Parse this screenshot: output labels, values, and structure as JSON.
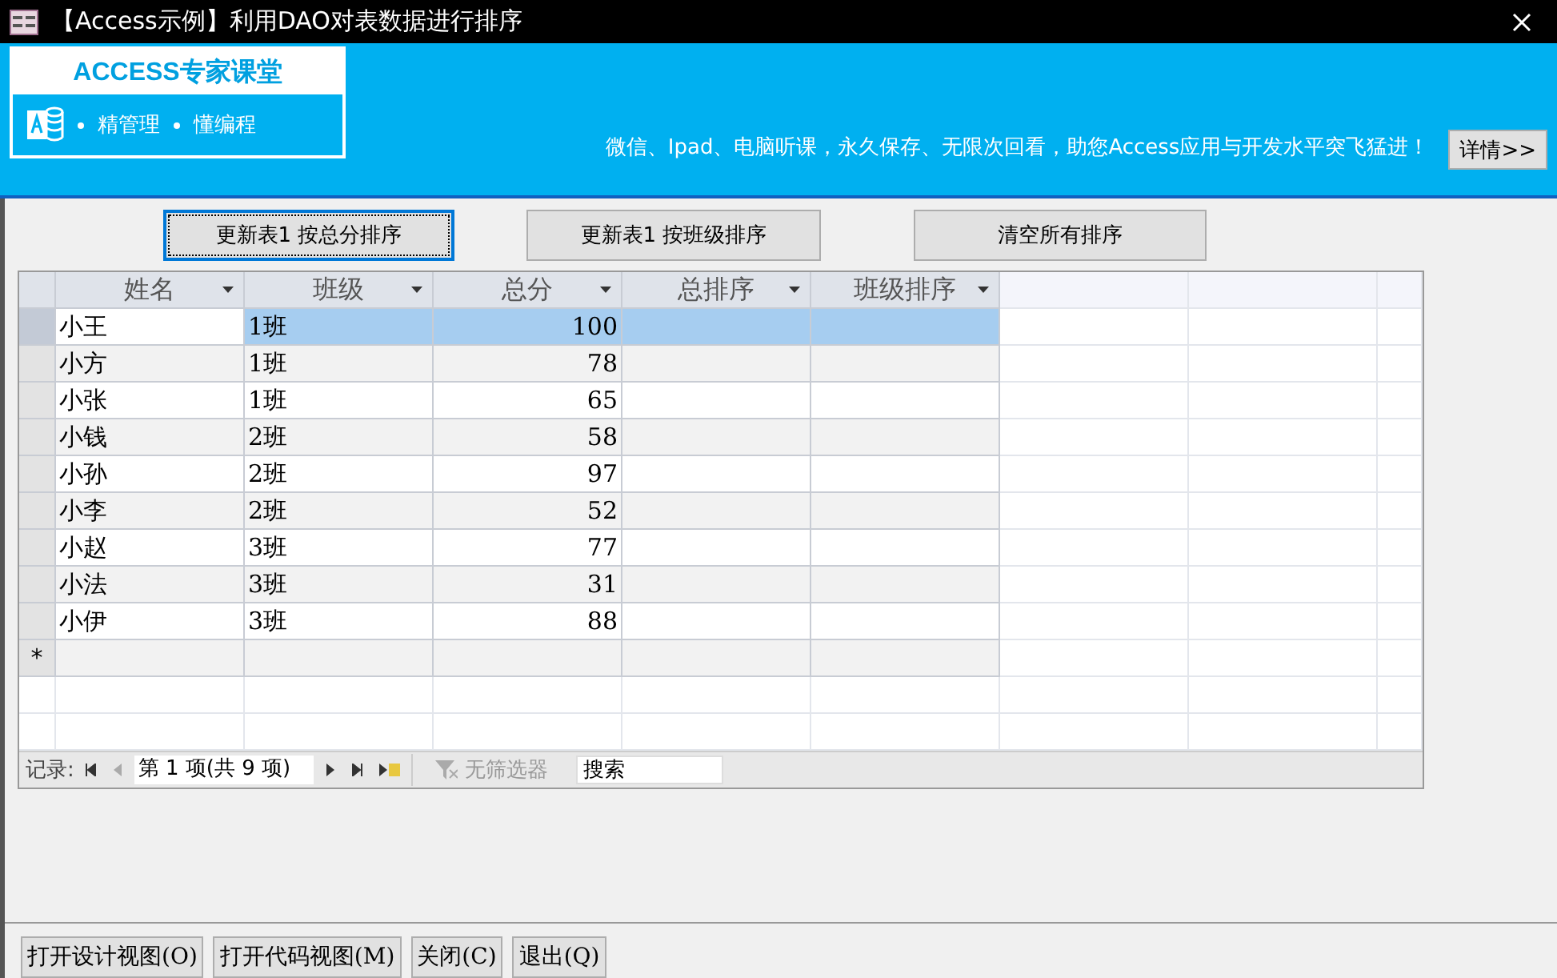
{
  "window": {
    "title": "【Access示例】利用DAO对表数据进行排序"
  },
  "banner": {
    "logo_title": "ACCESS专家课堂",
    "slogan_1": "精管理",
    "slogan_2": "懂编程",
    "message": "微信、Ipad、电脑听课，永久保存、无限次回看，助您Access应用与开发水平突飞猛进！",
    "details_button": "详情>>"
  },
  "actions": [
    {
      "label": "更新表1  按总分排序",
      "focused": true
    },
    {
      "label": "更新表1  按班级排序",
      "focused": false
    },
    {
      "label": "清空所有排序",
      "focused": false
    }
  ],
  "table": {
    "columns": [
      "姓名",
      "班级",
      "总分",
      "总排序",
      "班级排序"
    ],
    "rows": [
      {
        "cells": [
          "小王",
          "1班",
          "100",
          "",
          ""
        ],
        "selected": true
      },
      {
        "cells": [
          "小方",
          "1班",
          "78",
          "",
          ""
        ],
        "selected": false
      },
      {
        "cells": [
          "小张",
          "1班",
          "65",
          "",
          ""
        ],
        "selected": false
      },
      {
        "cells": [
          "小钱",
          "2班",
          "58",
          "",
          ""
        ],
        "selected": false
      },
      {
        "cells": [
          "小孙",
          "2班",
          "97",
          "",
          ""
        ],
        "selected": false
      },
      {
        "cells": [
          "小李",
          "2班",
          "52",
          "",
          ""
        ],
        "selected": false
      },
      {
        "cells": [
          "小赵",
          "3班",
          "77",
          "",
          ""
        ],
        "selected": false
      },
      {
        "cells": [
          "小法",
          "3班",
          "31",
          "",
          ""
        ],
        "selected": false
      },
      {
        "cells": [
          "小伊",
          "3班",
          "88",
          "",
          ""
        ],
        "selected": false
      }
    ],
    "new_row_marker": "*"
  },
  "navigator": {
    "label": "记录:",
    "position": "第 1 项(共 9 项)",
    "filter": "无筛选器",
    "search_placeholder": "搜索"
  },
  "footer_buttons": [
    "打开设计视图(O)",
    "打开代码视图(M)",
    "关闭(C)",
    "退出(Q)"
  ]
}
